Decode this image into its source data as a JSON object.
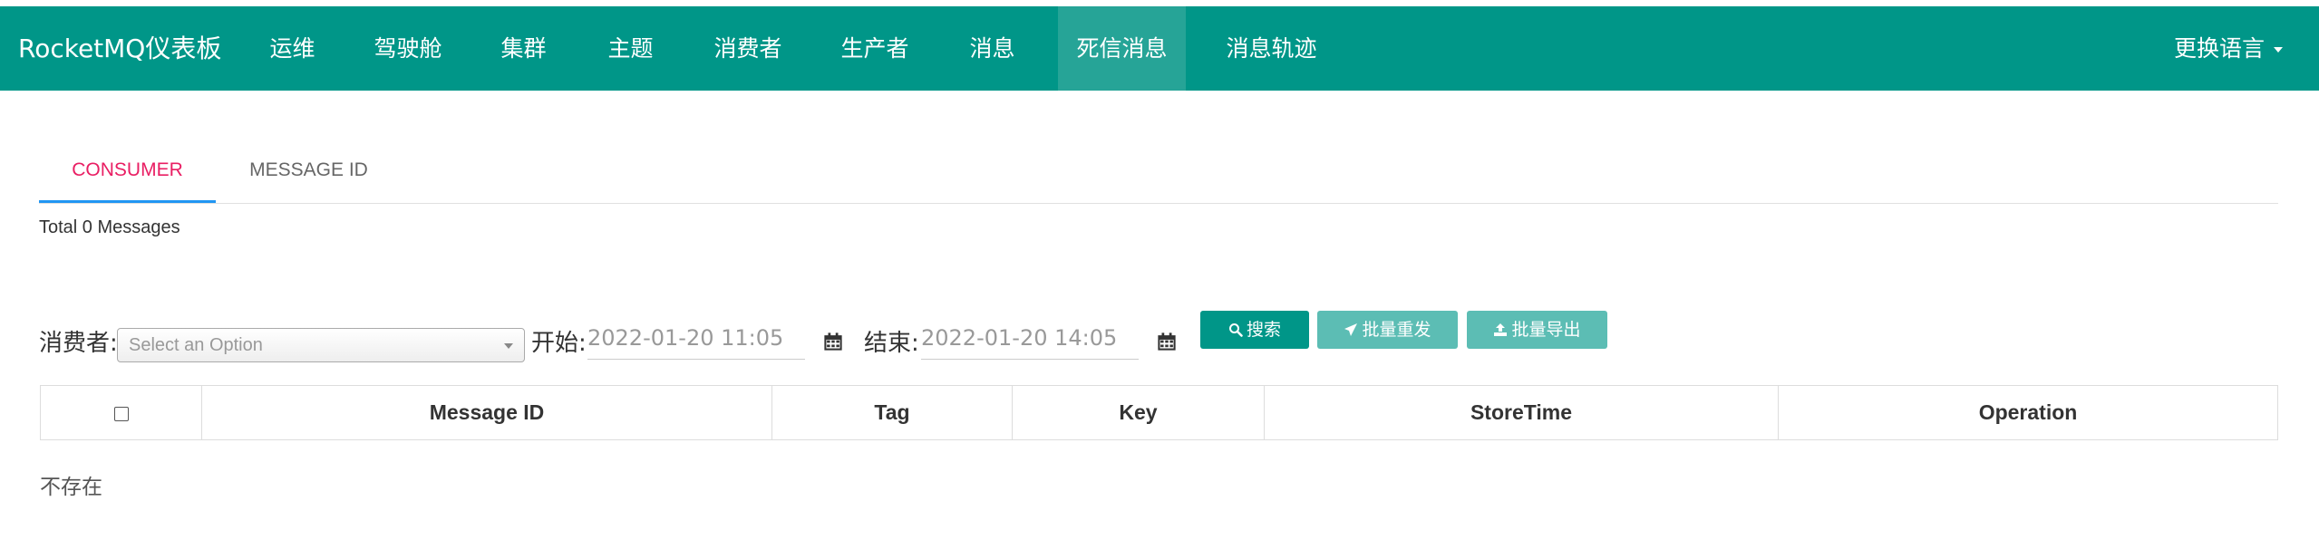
{
  "navbar": {
    "brand": "RocketMQ仪表板",
    "items": [
      "运维",
      "驾驶舱",
      "集群",
      "主题",
      "消费者",
      "生产者",
      "消息",
      "死信消息",
      "消息轨迹"
    ],
    "active_index": 7,
    "language_label": "更换语言",
    "colors": {
      "background": "#009688",
      "active": "#26a497"
    }
  },
  "tabs": {
    "items": [
      "CONSUMER",
      "MESSAGE ID"
    ],
    "active_index": 0
  },
  "summary": {
    "total_text": "Total 0 Messages"
  },
  "filter": {
    "consumer_label": "消费者:",
    "consumer_placeholder": "Select an Option",
    "start_label": "开始:",
    "start_value": "2022-01-20 11:05",
    "end_label": "结束:",
    "end_value": "2022-01-20 14:05",
    "search_button": "搜索",
    "batch_resend_button": "批量重发",
    "batch_export_button": "批量导出"
  },
  "table": {
    "columns": [
      "Message ID",
      "Tag",
      "Key",
      "StoreTime",
      "Operation"
    ],
    "empty_text": "不存在"
  }
}
